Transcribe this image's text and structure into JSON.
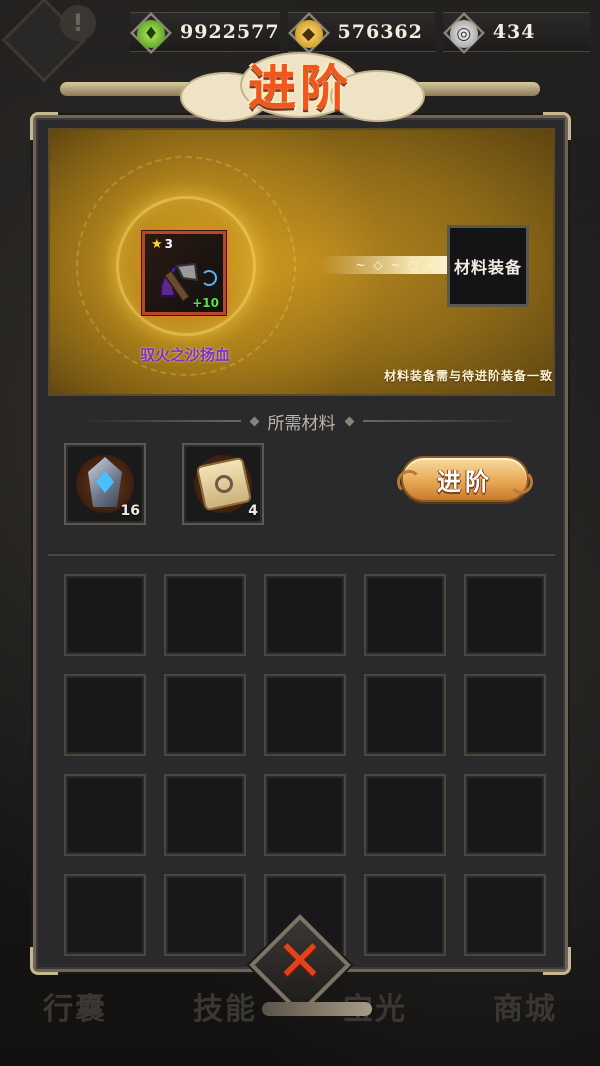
{
  "currencies": [
    {
      "icon": "jade-icon",
      "value": "9922577"
    },
    {
      "icon": "copper-coin-icon",
      "value": "576362"
    },
    {
      "icon": "soul-orb-icon",
      "value": "434"
    }
  ],
  "title": "进阶",
  "source_item": {
    "name": "驭火之沙扬血",
    "stars": "3",
    "enhance_level": "+10"
  },
  "target_slot_label": "材料装备",
  "hint": "材料装备需与待进阶装备一致",
  "required_materials_label": "所需材料",
  "materials": [
    {
      "icon": "crystal-gem-icon",
      "count": "16"
    },
    {
      "icon": "scroll-icon",
      "count": "4"
    }
  ],
  "advance_button_label": "进阶",
  "background_nav": [
    "行囊",
    "技能",
    "宝光",
    "商城"
  ],
  "inventory_slots": 20,
  "close_icon": "close-x-icon",
  "colors": {
    "title": "#f2561d",
    "item_name": "#7a2fd2",
    "enhance": "#58e04a",
    "close_x": "#e2421c",
    "button": "#e8a955"
  }
}
